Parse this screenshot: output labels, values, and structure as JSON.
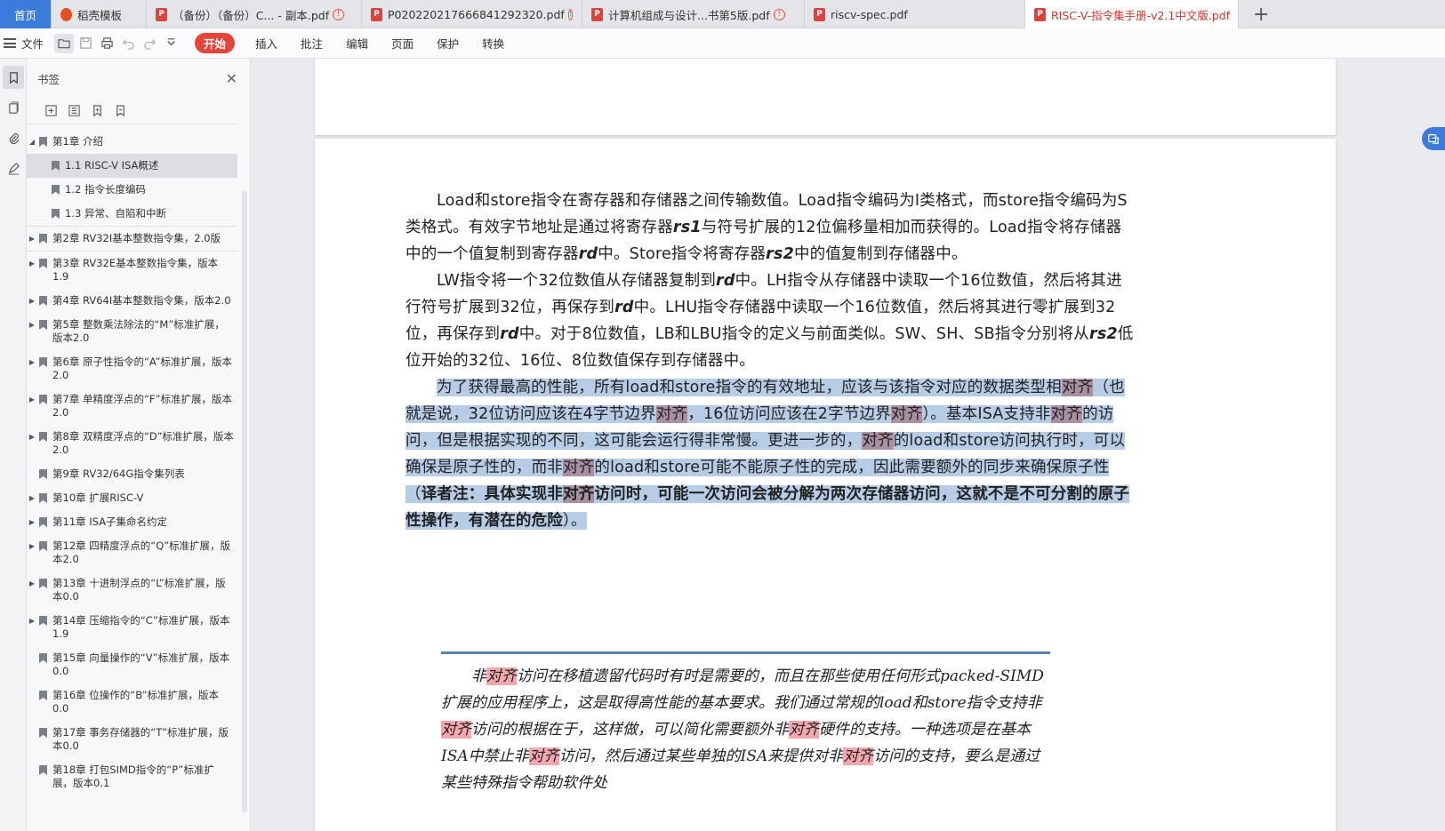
{
  "tabs": [
    {
      "label": "首页",
      "kind": "home"
    },
    {
      "label": "稻壳模板",
      "kind": "wps"
    },
    {
      "label": "（备份）（备份）C... - 副本.pdf",
      "kind": "pdf",
      "warn": true
    },
    {
      "label": "P020220217666841292320.pdf",
      "kind": "pdf",
      "warn": true
    },
    {
      "label": "计算机组成与设计...书第5版.pdf",
      "kind": "pdf",
      "warn": true
    },
    {
      "label": "riscv-spec.pdf",
      "kind": "pdf",
      "warn": false
    },
    {
      "label": "RISC-V-指令集手册-v2.1中文版.pdf",
      "kind": "pdf",
      "active": true
    }
  ],
  "toolbar": {
    "file_label": "文件",
    "start_label": "开始",
    "menus": [
      "插入",
      "批注",
      "编辑",
      "页面",
      "保护",
      "转换"
    ]
  },
  "panel": {
    "title": "书签"
  },
  "bookmarks": [
    {
      "label": "第1章 介绍",
      "level": 1,
      "expanded": true
    },
    {
      "label": "1.1 RISC-V ISA概述",
      "level": 2,
      "selected": true
    },
    {
      "label": "1.2 指令长度编码",
      "level": 2
    },
    {
      "label": "1.3 异常、自陷和中断",
      "level": 2
    },
    {
      "label": "第2章 RV32I基本整数指令集，2.0版",
      "level": 1,
      "collapsed": true,
      "boxed": true
    },
    {
      "label": "第3章 RV32E基本整数指令集，版本1.9",
      "level": 1,
      "collapsed": true
    },
    {
      "label": "第4章 RV64I基本整数指令集，版本2.0",
      "level": 1,
      "collapsed": true
    },
    {
      "label": "第5章 整数乘法除法的“M”标准扩展，版本2.0",
      "level": 1,
      "collapsed": true
    },
    {
      "label": "第6章 原子性指令的“A”标准扩展，版本2.0",
      "level": 1,
      "collapsed": true
    },
    {
      "label": "第7章 单精度浮点的“F”标准扩展，版本2.0",
      "level": 1,
      "collapsed": true
    },
    {
      "label": "第8章 双精度浮点的“D”标准扩展，版本2.0",
      "level": 1,
      "collapsed": true
    },
    {
      "label": "第9章 RV32/64G指令集列表",
      "level": 1
    },
    {
      "label": "第10章 扩展RISC-V",
      "level": 1,
      "collapsed": true
    },
    {
      "label": "第11章 ISA子集命名约定",
      "level": 1,
      "collapsed": true
    },
    {
      "label": "第12章 四精度浮点的“Q”标准扩展，版本2.0",
      "level": 1,
      "collapsed": true
    },
    {
      "label": "第13章 十进制浮点的“L”标准扩展，版本0.0",
      "level": 1,
      "collapsed": true
    },
    {
      "label": "第14章 压缩指令的“C”标准扩展，版本1.9",
      "level": 1,
      "collapsed": true
    },
    {
      "label": "第15章 向量操作的“V”标准扩展，版本0.0",
      "level": 1
    },
    {
      "label": "第16章 位操作的“B”标准扩展，版本0.0",
      "level": 1
    },
    {
      "label": "第17章 事务存储器的“T”标准扩展，版本0.0",
      "level": 1
    },
    {
      "label": "第18章 打包SIMD指令的“P”标准扩展，版本0.1",
      "level": 1
    }
  ],
  "doc": {
    "para1": "Load和store指令在寄存器和存储器之间传输数值。Load指令编码为I类格式，而store指令编码为S类格式。有效字节地址是通过将寄存器rs1与符号扩展的12位偏移量相加而获得的。Load指令将存储器中的一个值复制到寄存器rd中。Store指令将寄存器rs2中的值复制到存储器中。",
    "para2": "LW指令将一个32位数值从存储器复制到rd中。LH指令从存储器中读取一个16位数值，然后将其进行符号扩展到32位，再保存到rd中。LHU指令存储器中读取一个16位数值，然后将其进行零扩展到32位，再保存到rd中。对于8位数值，LB和LBU指令的定义与前面类似。SW、SH、SB指令分别将从rs2低位开始的32位、16位、8位数值保存到存储器中。",
    "para3": "为了获得最高的性能，所有load和store指令的有效地址，应该与该指令对应的数据类型相对齐（也就是说，32位访问应该在4字节边界对齐，16位访问应该在2字节边界对齐）。基本ISA支持非对齐的访问，但是根据实现的不同，这可能会运行得非常慢。更进一步的，对齐的load和store访问执行时，可以确保是原子性的，而非对齐的load和store可能不能原子性的完成，因此需要额外的同步来确保原子性（译者注：具体实现非对齐访问时，可能一次访问会被分解为两次存储器访问，这就不是不可分割的原子性操作，有潜在的危险）。",
    "quote": "非对齐访问在移植遗留代码时有时是需要的，而且在那些使用任何形式packed-SIMD扩展的应用程序上，这是取得高性能的基本要求。我们通过常规的load和store指令支持非对齐访问的根据在于，这样做，可以简化需要额外非对齐硬件的支持。一种选项是在基本ISA中禁止非对齐访问，然后通过某些单独的ISA来提供对非对齐访问的支持，要么是通过某些特殊指令帮助软件处"
  },
  "colors": {
    "accent": "#e94238",
    "highlight": "#b7cde6",
    "highlight_dark": "#a88fa2",
    "pink_mark": "#f4a8ae",
    "rule": "#5a7fb4"
  }
}
